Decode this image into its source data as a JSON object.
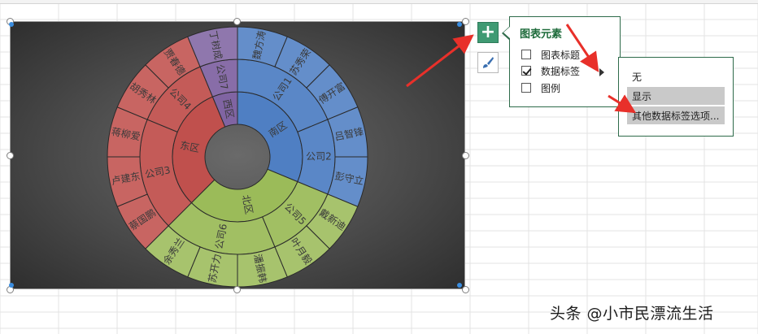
{
  "chart": {
    "regions": [
      {
        "name": "南区",
        "color": "#4f7fc3",
        "companies": [
          {
            "name": "公司1",
            "people": [
              "魏方涛",
              "苏秀荣",
              "傅开富"
            ]
          },
          {
            "name": "公司2",
            "people": [
              "吕智锋",
              "彭守立"
            ]
          }
        ]
      },
      {
        "name": "北区",
        "color": "#9bbb59",
        "companies": [
          {
            "name": "公司5",
            "people": [
              "戴新迪",
              "叶月毅"
            ]
          },
          {
            "name": "公司6",
            "people": [
              "潘振韩",
              "苏开力",
              "余秀兰"
            ]
          }
        ]
      },
      {
        "name": "东区",
        "color": "#c0504d",
        "companies": [
          {
            "name": "公司3",
            "people": [
              "蔡国鹏",
              "卢建东",
              "蒋柳爱"
            ]
          },
          {
            "name": "公司4",
            "people": [
              "胡秀林",
              "贾春德"
            ]
          }
        ]
      },
      {
        "name": "西区",
        "color": "#8064a2",
        "companies": [
          {
            "name": "公司7",
            "people": [
              "丁树成"
            ]
          }
        ]
      }
    ]
  },
  "panel": {
    "title": "图表元素",
    "options": [
      {
        "label": "图表标题",
        "checked": false
      },
      {
        "label": "数据标签",
        "checked": true
      },
      {
        "label": "图例",
        "checked": false
      }
    ]
  },
  "submenu": {
    "items": [
      {
        "label": "无",
        "highlighted": false
      },
      {
        "label": "显示",
        "highlighted": true
      },
      {
        "label": "其他数据标签选项...",
        "highlighted": true
      }
    ]
  },
  "buttons": {
    "plus_label": "+"
  },
  "watermark": "头条 @小市民漂流生活",
  "colors": {
    "accent_green": "#3f9a73",
    "arrow_red": "#e8302a",
    "panel_border": "#2e6b4a"
  }
}
